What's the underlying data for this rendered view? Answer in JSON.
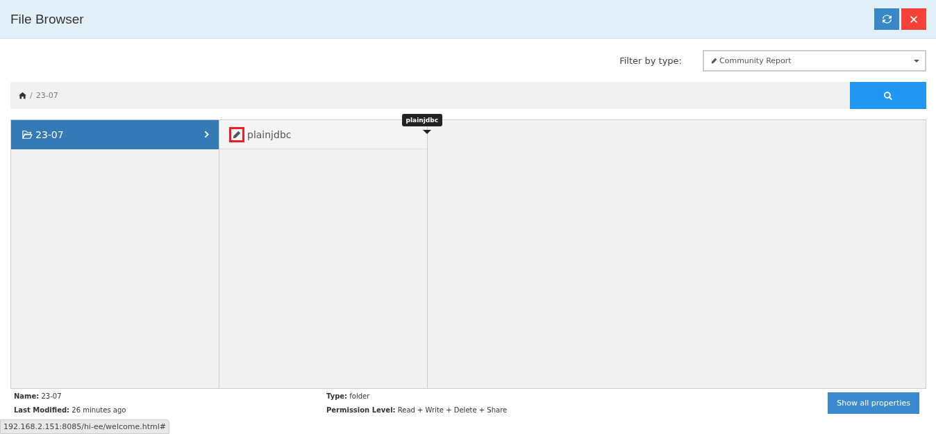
{
  "window": {
    "title": "File Browser"
  },
  "header_buttons": [
    {
      "kind": "refresh",
      "color": "#3a87c8"
    },
    {
      "kind": "close",
      "color": "#f44336"
    }
  ],
  "filter": {
    "label": "Filter by type:",
    "value": "Community Report"
  },
  "breadcrumb": {
    "separator": "/",
    "items": [
      "23-07"
    ]
  },
  "columns": [
    {
      "items": [
        {
          "name": "23-07",
          "kind": "folder",
          "selected": true,
          "highlighted": false
        }
      ]
    },
    {
      "items": [
        {
          "name": "plainjdbc",
          "kind": "report",
          "selected": false,
          "highlighted": true,
          "tooltip": "plainjdbc"
        }
      ]
    }
  ],
  "properties": [
    {
      "label": "Name:",
      "value": "23-07"
    },
    {
      "label": "Type:",
      "value": "folder"
    },
    {
      "label": "Last Modified:",
      "value": "26 minutes ago"
    },
    {
      "label": "Permission Level:",
      "value": "Read + Write + Delete + Share"
    }
  ],
  "show_all_button": "Show all properties",
  "status_bar": "192.168.2.151:8085/hi-ee/welcome.html#"
}
